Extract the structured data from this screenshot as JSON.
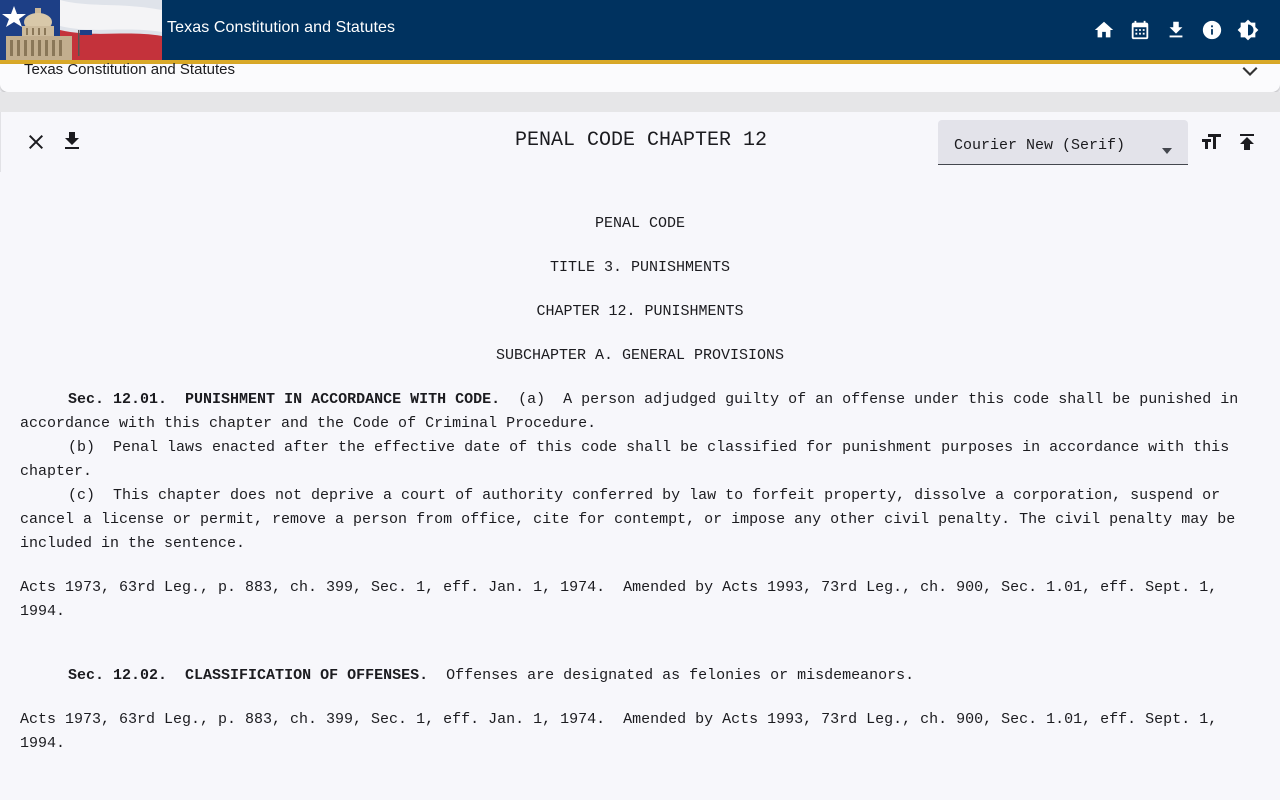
{
  "app": {
    "title": "Texas Constitution and Statutes",
    "brand_color": "#00325f",
    "accent_color": "#d9a928",
    "actions": [
      "home-icon",
      "calendar-icon",
      "download-icon",
      "info-icon",
      "brightness-icon"
    ]
  },
  "accordion": {
    "label": "Texas Constitution and Statutes"
  },
  "viewer": {
    "heading": "PENAL CODE CHAPTER 12",
    "font_select": {
      "selected": "Courier New (Serif)"
    }
  },
  "document": {
    "headings": [
      "PENAL CODE",
      "TITLE 3. PUNISHMENTS",
      "CHAPTER 12. PUNISHMENTS",
      "SUBCHAPTER A. GENERAL PROVISIONS"
    ],
    "sections": [
      {
        "number": "Sec. 12.01.",
        "title": "PUNISHMENT IN ACCORDANCE WITH CODE.",
        "lead": "  (a)  A person adjudged guilty of an offense under this code shall be punished in accordance with this chapter and the Code of Criminal Procedure.",
        "subsections": [
          "(b)  Penal laws enacted after the effective date of this code shall be classified for punishment purposes in accordance with this chapter.",
          "(c)  This chapter does not deprive a court of authority conferred by law to forfeit property, dissolve a corporation, suspend or cancel a license or permit, remove a person from office, cite for contempt, or impose any other civil penalty. The civil penalty may be included in the sentence."
        ],
        "history": "Acts 1973, 63rd Leg., p. 883, ch. 399, Sec. 1, eff. Jan. 1, 1974.  Amended by Acts 1993, 73rd Leg., ch. 900, Sec. 1.01, eff. Sept. 1, 1994."
      },
      {
        "number": "Sec. 12.02.",
        "title": "CLASSIFICATION OF OFFENSES.",
        "lead": "  Offenses are designated as felonies or misdemeanors.",
        "history": "Acts 1973, 63rd Leg., p. 883, ch. 399, Sec. 1, eff. Jan. 1, 1974.  Amended by Acts 1993, 73rd Leg., ch. 900, Sec. 1.01, eff. Sept. 1, 1994."
      }
    ]
  }
}
